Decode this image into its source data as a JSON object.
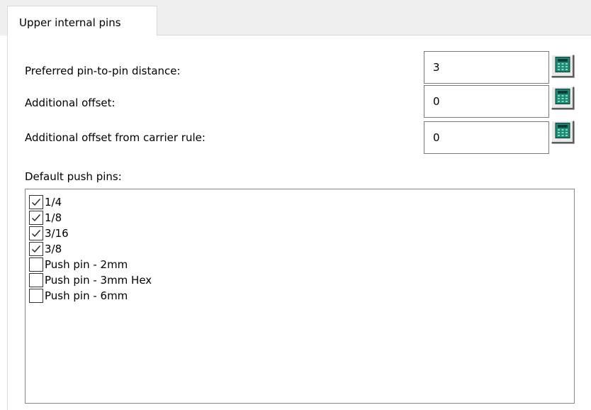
{
  "tab": {
    "label": "Upper internal pins"
  },
  "fields": [
    {
      "label": "Preferred pin-to-pin distance:",
      "value": "3",
      "button_icon": "calculator-icon"
    },
    {
      "label": "Additional offset:",
      "value": "0",
      "button_icon": "calculator-icon"
    },
    {
      "label": "Additional offset from carrier rule:",
      "value": "0",
      "button_icon": "calculator-icon"
    }
  ],
  "push_pins": {
    "label": "Default push pins:",
    "items": [
      {
        "label": "1/4",
        "checked": true
      },
      {
        "label": "1/8",
        "checked": true
      },
      {
        "label": "3/16",
        "checked": true
      },
      {
        "label": "3/8",
        "checked": true
      },
      {
        "label": "Push pin - 2mm",
        "checked": false
      },
      {
        "label": "Push pin - 3mm Hex",
        "checked": false
      },
      {
        "label": "Push pin - 6mm",
        "checked": false
      }
    ]
  },
  "colors": {
    "calculator_body": "#1f8a73",
    "calculator_screen": "#0f3d36",
    "calculator_keys": "#7fdcc4"
  }
}
